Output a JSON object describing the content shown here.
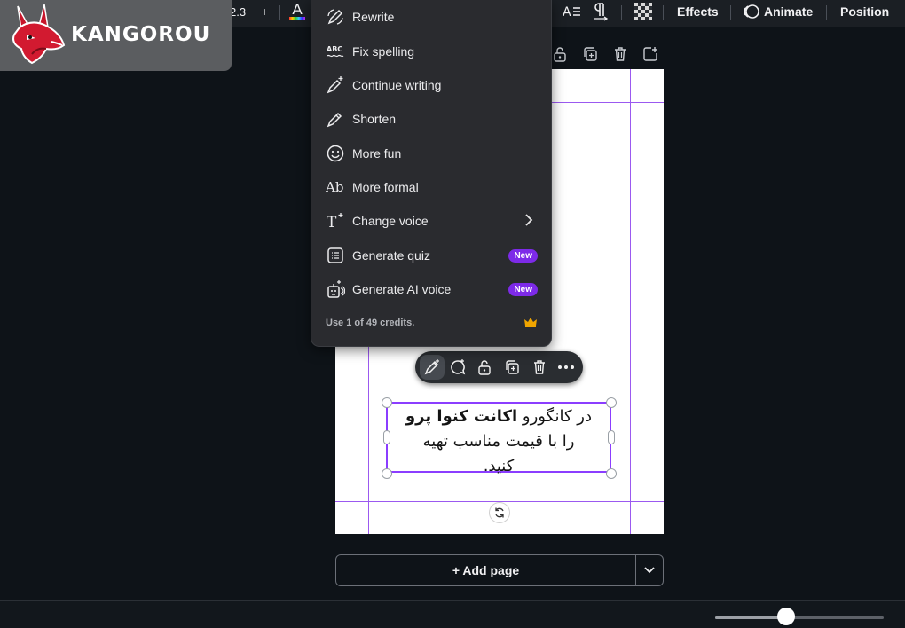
{
  "brand": {
    "name": "KANGOROU"
  },
  "toolbar": {
    "font_size": "2.3",
    "increase": "+",
    "text_color_glyph": "A",
    "effects": "Effects",
    "animate": "Animate",
    "position": "Position"
  },
  "menu": {
    "items": [
      {
        "label": "Rewrite",
        "icon": "rewrite-icon"
      },
      {
        "label": "Fix spelling",
        "icon": "abc-spelling-icon",
        "icon_text": "ABC"
      },
      {
        "label": "Continue writing",
        "icon": "pen-sparkle-icon"
      },
      {
        "label": "Shorten",
        "icon": "pen-shorten-icon"
      },
      {
        "label": "More fun",
        "icon": "smiley-icon"
      },
      {
        "label": "More formal",
        "icon": "ab-formal-icon",
        "icon_text": "Ab"
      },
      {
        "label": "Change voice",
        "icon": "text-voice-icon",
        "icon_text": "T"
      },
      {
        "label": "Generate quiz",
        "icon": "quiz-icon",
        "badge": "New"
      },
      {
        "label": "Generate AI voice",
        "icon": "ai-voice-icon",
        "badge": "New"
      }
    ],
    "credits": "Use 1 of 49 credits."
  },
  "textbox": {
    "line1_plain": "در کانگورو ",
    "line1_bold": "اکانت کنوا پرو",
    "line2": "را با قیمت مناسب تهیه",
    "line3": "کنید."
  },
  "add_page": {
    "label": "+ Add page"
  },
  "zoom": {
    "level": 0.42
  },
  "colors": {
    "accent": "#8b3dff",
    "badge": "#7d2ae8",
    "guide": "#9b59f0"
  }
}
